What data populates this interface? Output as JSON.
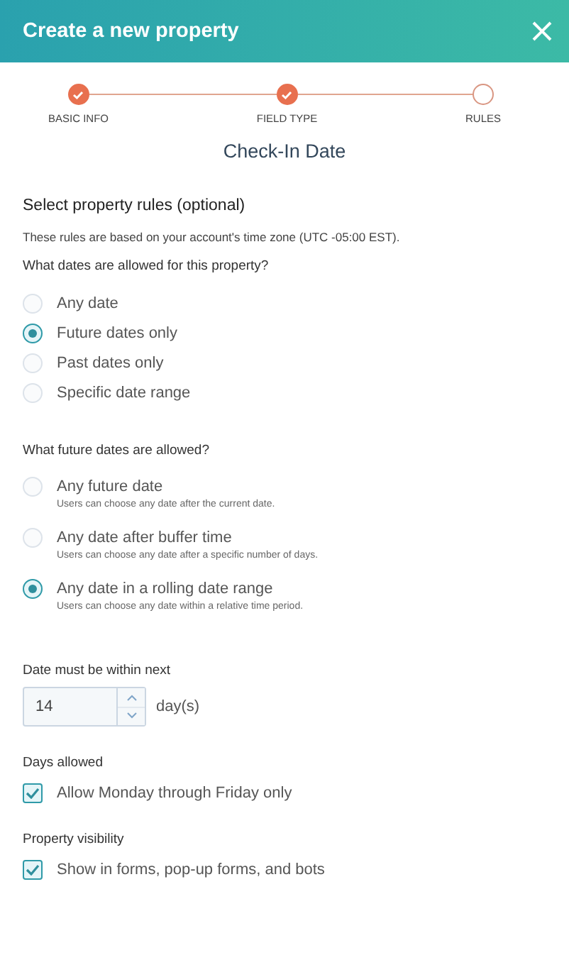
{
  "header": {
    "title": "Create a new property"
  },
  "steps": [
    {
      "label": "BASIC INFO",
      "done": true
    },
    {
      "label": "FIELD TYPE",
      "done": true
    },
    {
      "label": "RULES",
      "done": false
    }
  ],
  "subtitle": "Check-In Date",
  "rules_heading": "Select property rules (optional)",
  "timezone_note": "These rules are based on your account's time zone (UTC -05:00 EST).",
  "date_question": "What dates are allowed for this property?",
  "date_options": [
    {
      "label": "Any date",
      "selected": false
    },
    {
      "label": "Future dates only",
      "selected": true
    },
    {
      "label": "Past dates only",
      "selected": false
    },
    {
      "label": "Specific date range",
      "selected": false
    }
  ],
  "future_question": "What future dates are allowed?",
  "future_options": [
    {
      "label": "Any future date",
      "description": "Users can choose any date after the current date.",
      "selected": false
    },
    {
      "label": "Any date after buffer time",
      "description": "Users can choose any date after a specific number of days.",
      "selected": false
    },
    {
      "label": "Any date in a rolling date range",
      "description": "Users can choose any date within a relative time period.",
      "selected": true
    }
  ],
  "within": {
    "label": "Date must be within next",
    "value": "14",
    "unit": "day(s)"
  },
  "days_allowed": {
    "label": "Days allowed",
    "option": "Allow Monday through Friday only",
    "checked": true
  },
  "visibility": {
    "label": "Property visibility",
    "option": "Show in forms, pop-up forms, and bots",
    "checked": true
  }
}
